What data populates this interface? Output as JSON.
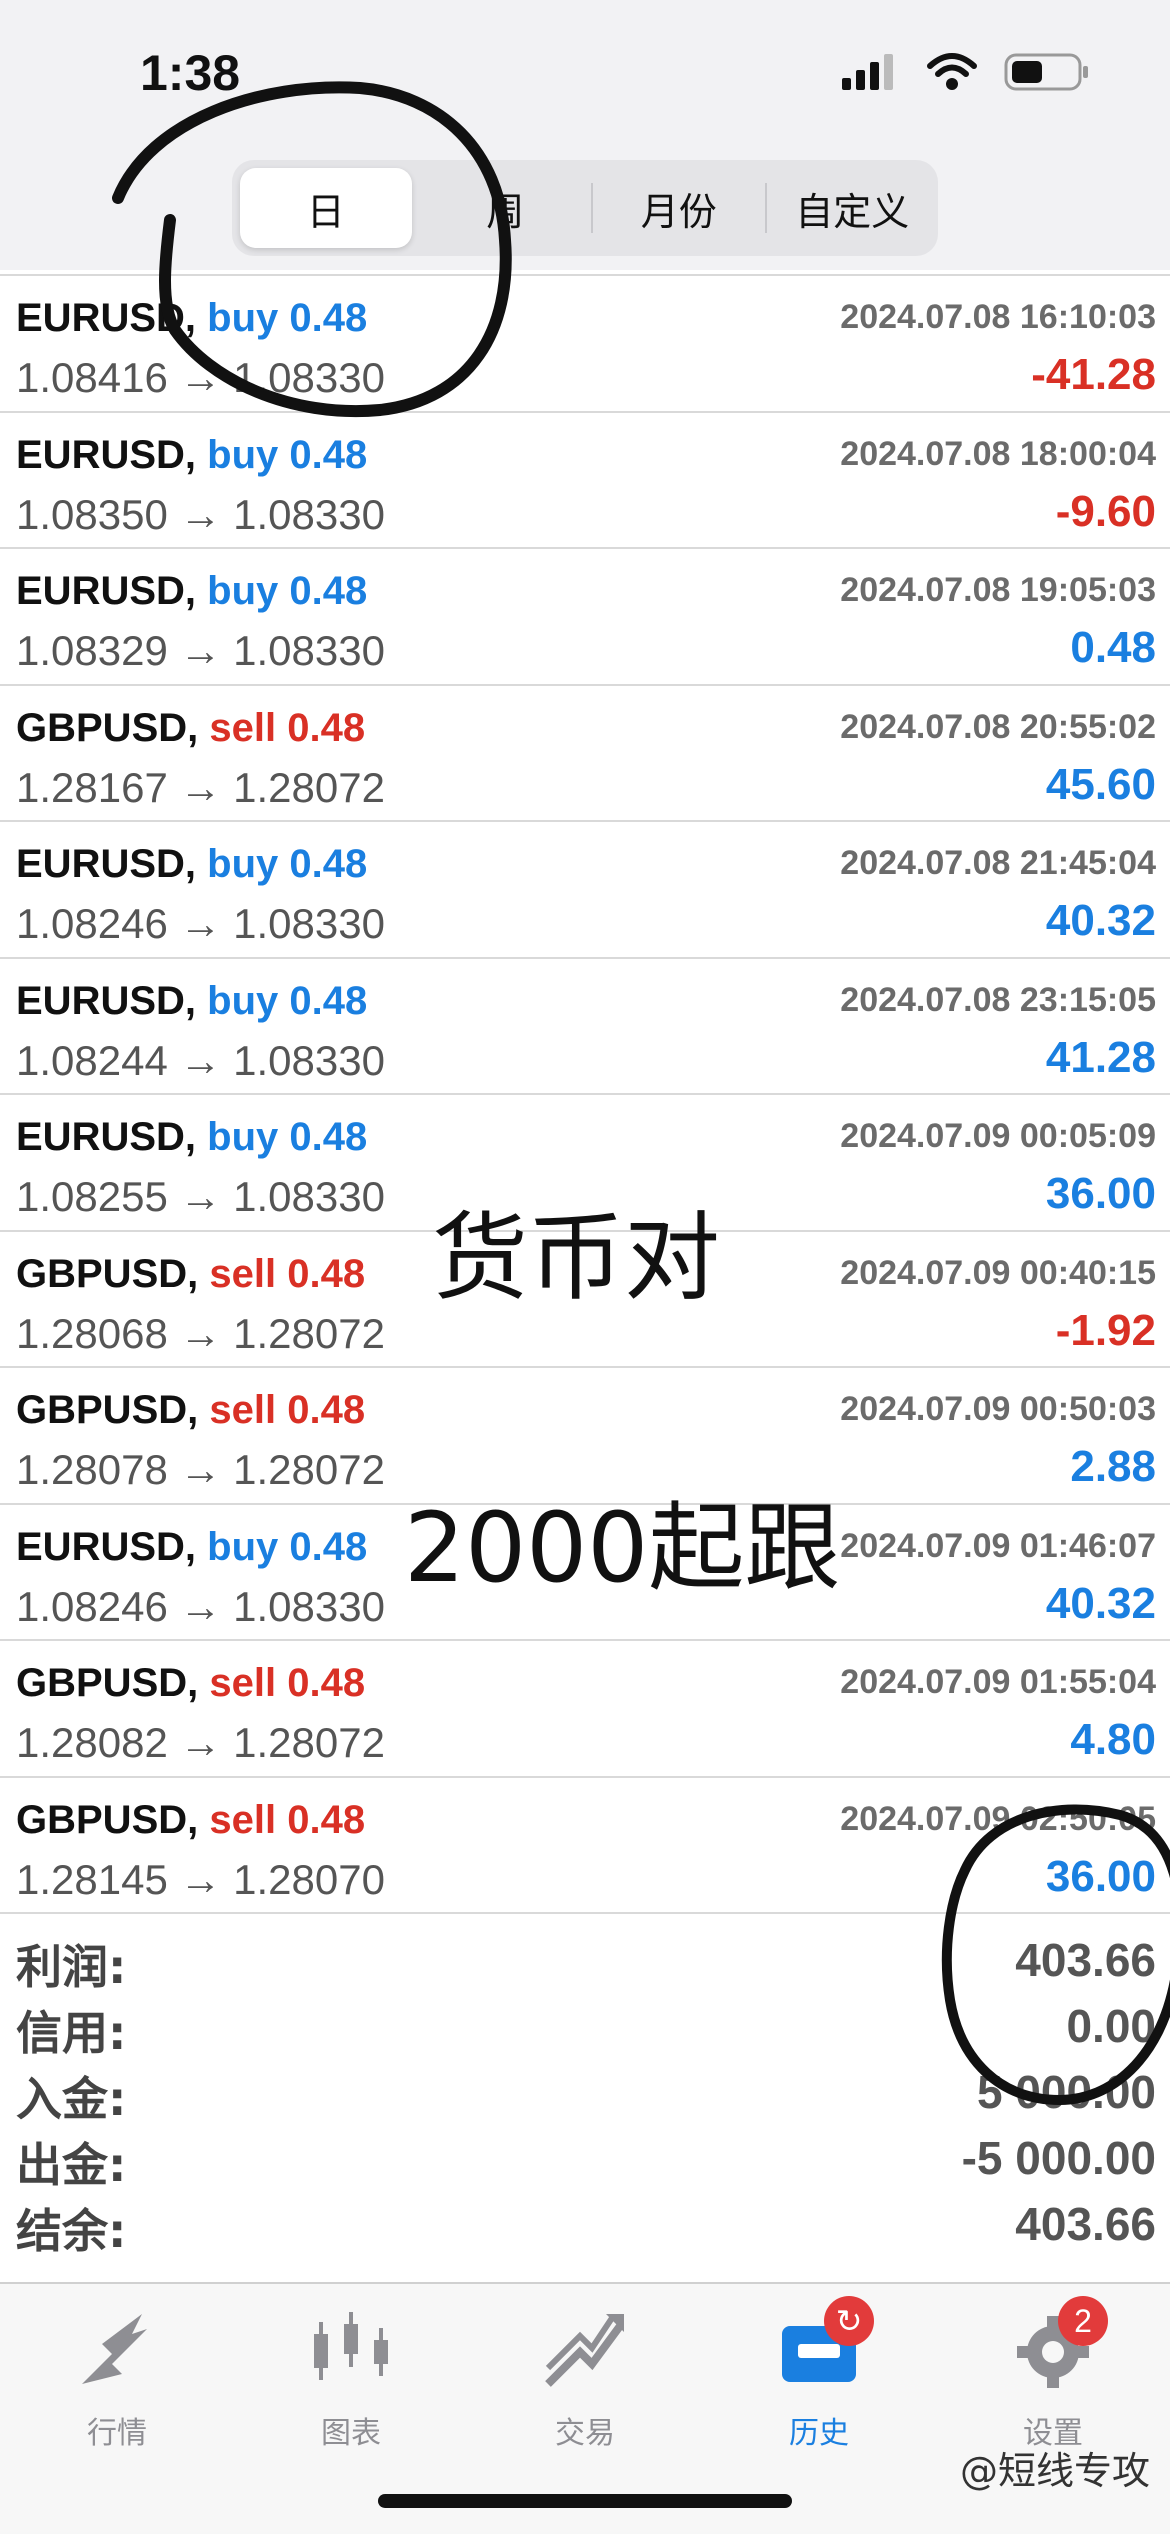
{
  "status_bar": {
    "time": "1:38",
    "icons": [
      "cellular-icon",
      "wifi-icon",
      "battery-icon"
    ]
  },
  "segmented": [
    "日",
    "周",
    "月份",
    "自定义"
  ],
  "selected_segment": "日",
  "deals": [
    {
      "symbol": "EURUSD,",
      "dir": "buy",
      "vol": "0.48",
      "time": "2024.07.08 16:10:03",
      "prices": "1.08416 → 1.08330",
      "profit": "-41.28"
    },
    {
      "symbol": "EURUSD,",
      "dir": "buy",
      "vol": "0.48",
      "time": "2024.07.08 18:00:04",
      "prices": "1.08350 → 1.08330",
      "profit": "-9.60"
    },
    {
      "symbol": "EURUSD,",
      "dir": "buy",
      "vol": "0.48",
      "time": "2024.07.08 19:05:03",
      "prices": "1.08329 → 1.08330",
      "profit": "0.48"
    },
    {
      "symbol": "GBPUSD,",
      "dir": "sell",
      "vol": "0.48",
      "time": "2024.07.08 20:55:02",
      "prices": "1.28167 → 1.28072",
      "profit": "45.60"
    },
    {
      "symbol": "EURUSD,",
      "dir": "buy",
      "vol": "0.48",
      "time": "2024.07.08 21:45:04",
      "prices": "1.08246 → 1.08330",
      "profit": "40.32"
    },
    {
      "symbol": "EURUSD,",
      "dir": "buy",
      "vol": "0.48",
      "time": "2024.07.08 23:15:05",
      "prices": "1.08244 → 1.08330",
      "profit": "41.28"
    },
    {
      "symbol": "EURUSD,",
      "dir": "buy",
      "vol": "0.48",
      "time": "2024.07.09 00:05:09",
      "prices": "1.08255 → 1.08330",
      "profit": "36.00"
    },
    {
      "symbol": "GBPUSD,",
      "dir": "sell",
      "vol": "0.48",
      "time": "2024.07.09 00:40:15",
      "prices": "1.28068 → 1.28072",
      "profit": "-1.92"
    },
    {
      "symbol": "GBPUSD,",
      "dir": "sell",
      "vol": "0.48",
      "time": "2024.07.09 00:50:03",
      "prices": "1.28078 → 1.28072",
      "profit": "2.88"
    },
    {
      "symbol": "EURUSD,",
      "dir": "buy",
      "vol": "0.48",
      "time": "2024.07.09 01:46:07",
      "prices": "1.08246 → 1.08330",
      "profit": "40.32"
    },
    {
      "symbol": "GBPUSD,",
      "dir": "sell",
      "vol": "0.48",
      "time": "2024.07.09 01:55:04",
      "prices": "1.28082 → 1.28072",
      "profit": "4.80"
    },
    {
      "symbol": "GBPUSD,",
      "dir": "sell",
      "vol": "0.48",
      "time": "2024.07.09 02:50:05",
      "prices": "1.28145 → 1.28070",
      "profit": "36.00"
    }
  ],
  "summary": [
    {
      "label": "利润:",
      "value": "403.66"
    },
    {
      "label": "信用:",
      "value": "0.00"
    },
    {
      "label": "入金:",
      "value": "5 000.00"
    },
    {
      "label": "出金:",
      "value": "-5 000.00"
    },
    {
      "label": "结余:",
      "value": "403.66"
    }
  ],
  "overlay_text": {
    "line1": "货币对",
    "line2": "2000起跟"
  },
  "tabs": [
    {
      "label": "行情",
      "icon": "quotes-icon"
    },
    {
      "label": "图表",
      "icon": "chart-icon"
    },
    {
      "label": "交易",
      "icon": "trade-icon"
    },
    {
      "label": "历史",
      "icon": "history-icon",
      "badge": ""
    },
    {
      "label": "设置",
      "icon": "gear-icon",
      "badge": "2"
    }
  ],
  "active_tab": "历史",
  "watermark": "@短线专攻",
  "colors": {
    "buy": "#1a7fe0",
    "sell": "#d93025",
    "profit_pos": "#1a7fe0",
    "profit_neg": "#d93025",
    "active_tab": "#1a7fe0"
  }
}
